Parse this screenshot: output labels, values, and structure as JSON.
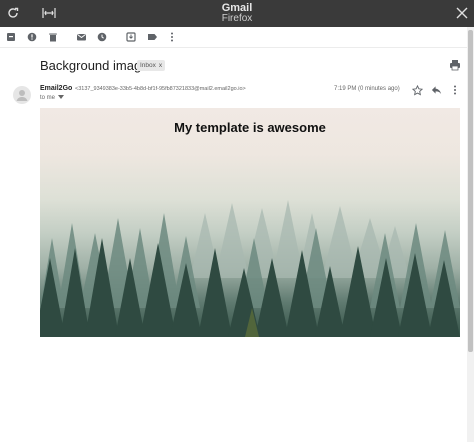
{
  "window": {
    "title": "Gmail",
    "subtitle": "Firefox"
  },
  "toolbar": {
    "icons": [
      "archive-icon",
      "report-spam-icon",
      "delete-icon",
      "mark-unread-icon",
      "snooze-icon",
      "move-to-icon",
      "label-icon",
      "more-vert-icon"
    ]
  },
  "email": {
    "subject": "Background images",
    "label": "Inbox",
    "label_close": "x",
    "sender_name": "Email2Go",
    "sender_email": "<3137_9349383e-33b5-4b8d-bf1f-95fb87321833@mail2.email2go.io>",
    "to": "to me",
    "timestamp": "7:19 PM (0 minutes ago)",
    "body_heading": "My template is awesome"
  },
  "colors": {
    "titlebar": "#3a3a3a",
    "icon_gray": "#5f6368"
  }
}
